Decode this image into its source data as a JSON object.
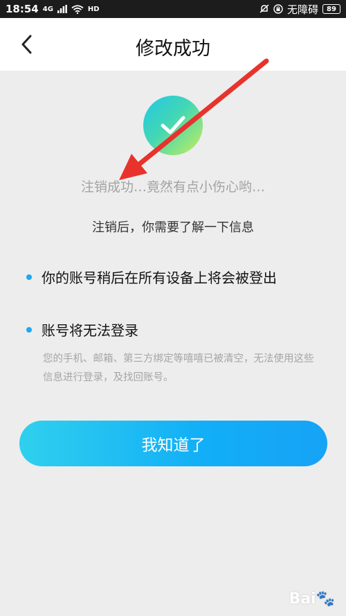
{
  "status_bar": {
    "time": "18:54",
    "network_type": "4G",
    "hd_label": "HD",
    "accessibility_text": "无障碍",
    "battery_level": "89"
  },
  "nav": {
    "title": "修改成功",
    "back_icon": "chevron-left-icon"
  },
  "success_icon": {
    "name": "check-circle-icon"
  },
  "content": {
    "headline": "注销成功…竟然有点小伤心哟…",
    "subtitle": "注销后，你需要了解一下信息",
    "bullets": [
      {
        "text": "你的账号稍后在所有设备上将会被登出"
      },
      {
        "text": "账号将无法登录"
      }
    ],
    "description": "您的手机、邮箱、第三方绑定等嘻嘻已被清空，无法使用这些信息进行登录，及找回账号。"
  },
  "button": {
    "label": "我知道了"
  },
  "annotation": {
    "arrow_color": "#e8322c"
  },
  "colors": {
    "accent": "#1fa8f2",
    "background": "#ededed"
  }
}
